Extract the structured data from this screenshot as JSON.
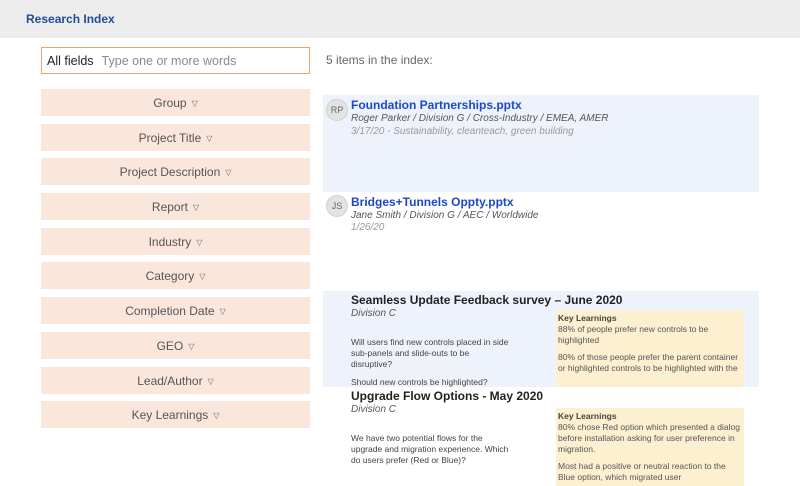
{
  "app": {
    "title": "Research Index"
  },
  "search": {
    "scope_label": "All fields",
    "placeholder": "Type one or more words"
  },
  "filters": [
    {
      "label": "Group"
    },
    {
      "label": "Project Title"
    },
    {
      "label": "Project Description"
    },
    {
      "label": "Report"
    },
    {
      "label": "Industry"
    },
    {
      "label": "Category"
    },
    {
      "label": "Completion Date"
    },
    {
      "label": "GEO"
    },
    {
      "label": "Lead/Author"
    },
    {
      "label": "Key Learnings"
    }
  ],
  "results": {
    "count_text": "5 items in the index:",
    "files": [
      {
        "initials": "RP",
        "title": "Foundation Partnerships.pptx",
        "meta": "Roger Parker / Division G / Cross-Industry / EMEA, AMER",
        "meta2": "3/17/20 - Sustainability, cleanteach, green building"
      },
      {
        "initials": "JS",
        "title": "Bridges+Tunnels Oppty.pptx",
        "meta": "Jane Smith / Division G / AEC / Worldwide",
        "meta2": "1/26/20"
      }
    ],
    "surveys": [
      {
        "title": "Seamless Update Feedback survey – June 2020",
        "division": "Division C",
        "questions": [
          "Will users find new controls placed in side sub-panels and slide-outs to be disruptive?",
          "Should new controls be highlighted?"
        ],
        "key_learnings_title": "Key Learnings",
        "learnings": [
          "88% of people prefer new controls to be highlighted",
          "80% of those people prefer the parent container or highlighted controls to be highlighted with the"
        ]
      },
      {
        "title": "Upgrade Flow Options - May 2020",
        "division": "Division C",
        "questions": [
          "We have two potential flows for the upgrade and migration experience. Which do users prefer (Red or Blue)?"
        ],
        "key_learnings_title": "Key Learnings",
        "learnings": [
          "80% chose Red option which presented a dialog before installation asking for user preference in migration.",
          "Most had a positive or neutral reaction to the Blue option, which migrated user"
        ]
      }
    ]
  },
  "colors": {
    "accent": "#1f4e96",
    "link": "#1e47c9",
    "filter_bg": "#fbe6dc",
    "search_border": "#f2a36b",
    "card_bg": "#eef3fb",
    "learnings_bg": "#fcf0d0"
  },
  "icons": {
    "filter_chevron": "chevron-down-icon"
  }
}
